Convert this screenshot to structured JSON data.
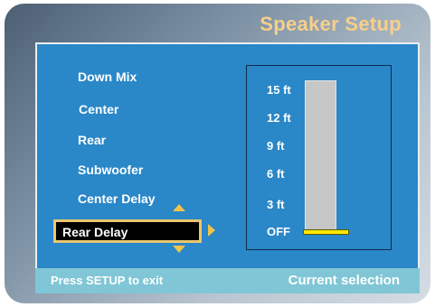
{
  "header": {
    "title": "Speaker Setup"
  },
  "menu": {
    "items": [
      "Down Mix",
      "Center",
      "Rear",
      "Subwoofer",
      "Center Delay"
    ],
    "selected": "Rear Delay"
  },
  "level": {
    "ticks": [
      "15 ft",
      "12 ft",
      "9 ft",
      "6 ft",
      "3 ft",
      "OFF"
    ],
    "current_value": "OFF"
  },
  "status": {
    "left": "Press SETUP to exit",
    "right": "Current selection"
  },
  "colors": {
    "panel": "#2a87c8",
    "title": "#f7cf8a",
    "highlight_border": "#e8c76e",
    "arrow": "#f0c34a",
    "bar": "#c7c7c7",
    "indicator": "#ffe800",
    "status_bar": "#80c6d6"
  },
  "icons": {
    "up": "arrow-up-icon",
    "down": "arrow-down-icon",
    "right": "arrow-right-icon"
  }
}
